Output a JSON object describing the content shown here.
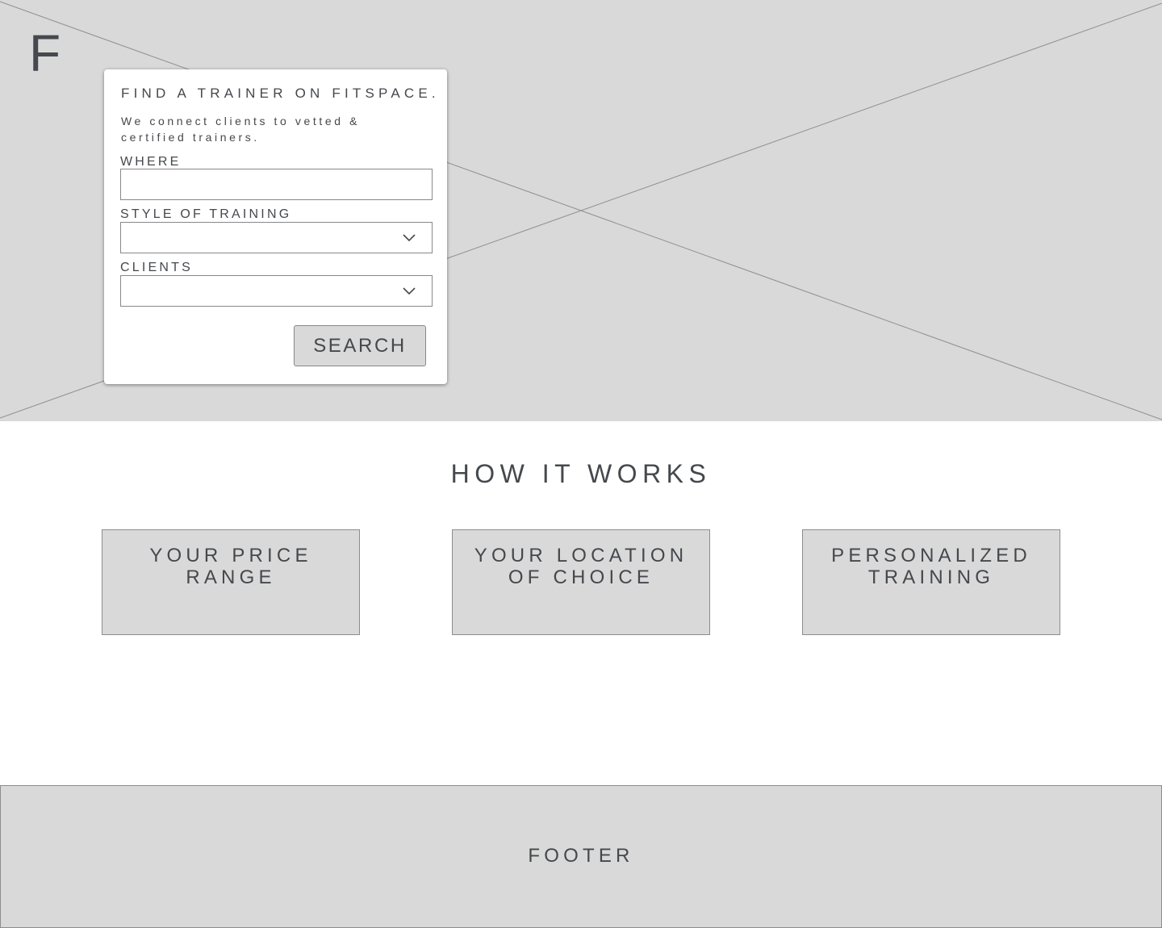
{
  "hero": {
    "logo": "F",
    "image_placeholder_icon": "image-placeholder-x"
  },
  "search_card": {
    "title": "FIND A TRAINER ON FITSPACE.",
    "subtitle": "We connect clients to vetted & certified trainers.",
    "fields": [
      {
        "label": "WHERE",
        "type": "text",
        "value": ""
      },
      {
        "label": "STYLE OF TRAINING",
        "type": "select",
        "value": "",
        "icon": "chevron-down-icon"
      },
      {
        "label": "CLIENTS",
        "type": "select",
        "value": "",
        "icon": "chevron-down-icon"
      }
    ],
    "search_label": "SEARCH"
  },
  "how_it_works": {
    "title": "HOW IT WORKS",
    "features": [
      {
        "label": "YOUR PRICE RANGE"
      },
      {
        "label": "YOUR LOCATION OF CHOICE"
      },
      {
        "label": "PERSONALIZED TRAINING"
      }
    ]
  },
  "footer": {
    "label": "FOOTER"
  },
  "colors": {
    "placeholder_gray": "#d9d9d9",
    "text": "#45484c",
    "border": "#888888",
    "card_bg": "#ffffff"
  }
}
